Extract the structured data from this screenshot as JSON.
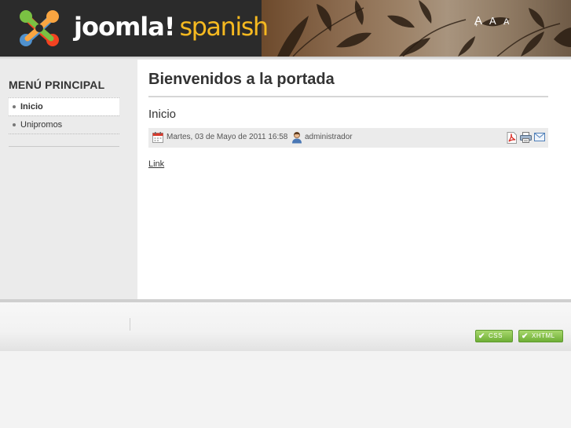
{
  "header": {
    "brand_main": "joomla!",
    "brand_sub": "spanish",
    "font_tools": {
      "increase": "A",
      "increase_sup": "+",
      "reset": "A",
      "decrease": "A",
      "decrease_sup": "-"
    }
  },
  "sidebar": {
    "title": "MENÚ PRINCIPAL",
    "items": [
      {
        "label": "Inicio",
        "active": true
      },
      {
        "label": "Unipromos",
        "active": false
      }
    ]
  },
  "main": {
    "page_title": "Bienvenidos a la portada",
    "article": {
      "title": "Inicio",
      "date": "Martes, 03 de Mayo de 2011 16:58",
      "author": "administrador",
      "link_text": "Link"
    }
  },
  "footer": {
    "badges": [
      "CSS",
      "XHTML"
    ]
  },
  "colors": {
    "brand_sub": "#f5b920",
    "header_bg": "#2b2b2b",
    "badge_green": "#6fae36"
  },
  "icons": [
    "joomla-logo",
    "calendar-icon",
    "user-icon",
    "pdf-icon",
    "print-icon",
    "email-icon",
    "check-icon"
  ]
}
